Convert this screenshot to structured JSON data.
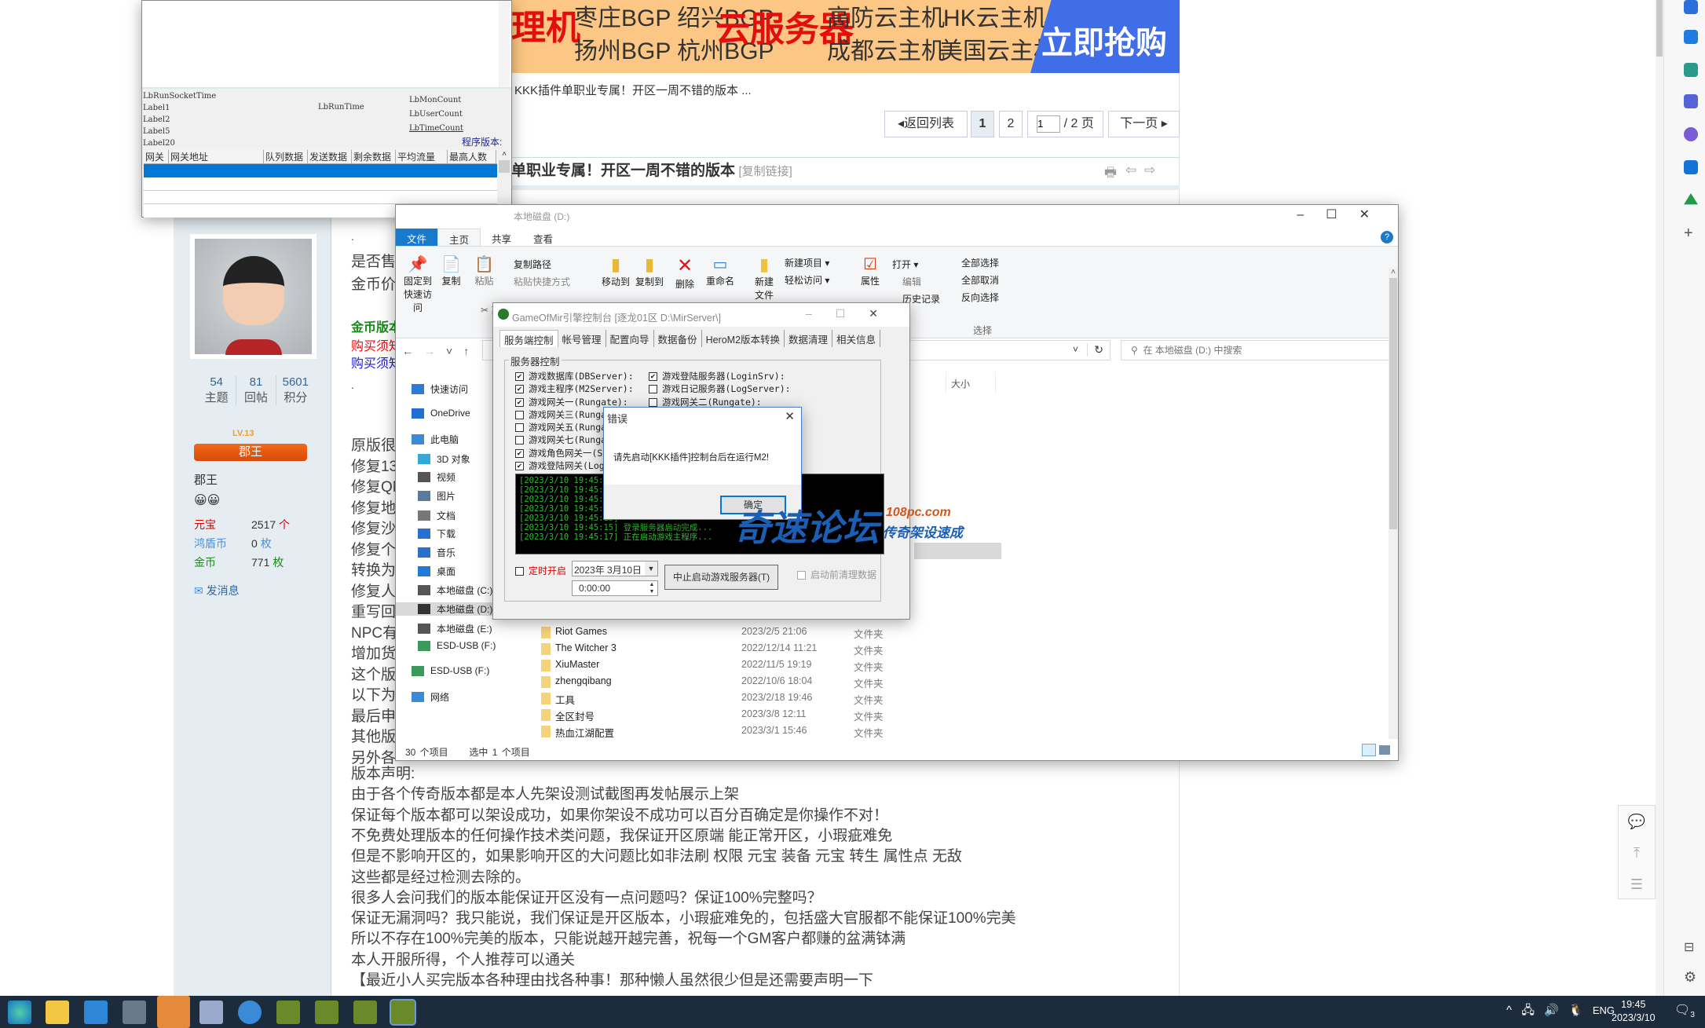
{
  "ad": {
    "left_red": "理机",
    "bgp1": "枣庄BGP 绍兴BGP",
    "bgp2": "扬州BGP 杭州BGP",
    "cloud": "云服务器",
    "host1": "高防云主机",
    "host2": "HK云主机",
    "host3": "成都云主机",
    "host4": "美国云主机",
    "buy": "立即抢购"
  },
  "thread": {
    "breadcrumb_title": "KKK插件单职业专属！开区一周不错的版本 ...",
    "title": "单职业专属！开区一周不错的版本",
    "copy_link": "[复制链接]"
  },
  "pagination": {
    "back": "返回列表",
    "page1": "1",
    "page2": "2",
    "page_input": "1",
    "total": "/ 2 页",
    "next": "下一页"
  },
  "user": {
    "topics": "54",
    "topics_label": "主题",
    "replies": "81",
    "replies_label": "回帖",
    "points": "5601",
    "points_label": "积分",
    "rank_badge": "郡王",
    "level": "LV.13",
    "rank": "郡王",
    "yuanbao_label": "元宝",
    "yuanbao": "2517",
    "yuanbao_unit": "个",
    "hongdun_label": "鸿盾币",
    "hongdun": "0",
    "hongdun_unit": "枚",
    "gold_label": "金币",
    "gold": "771",
    "gold_unit": "枚",
    "message": "发消息"
  },
  "post": {
    "top_lines": [
      ".",
      "是否售",
      "金币价",
      "."
    ],
    "gold_version": "金币版本",
    "buy_notice_red": "购买须知",
    "buy_notice_blue": "购买须知",
    "fragments": [
      "原版很",
      "修复13",
      "修复QM",
      "修复地",
      "修复沙",
      "修复个",
      "转换为",
      "修复人",
      "重写回",
      "NPC有",
      "增加货",
      "这个版",
      "以下为",
      "最后申",
      "其他版",
      "另外各"
    ],
    "lines": [
      "版本声明:",
      "由于各个传奇版本都是本人先架设测试截图再发帖展示上架",
      "保证每个版本都可以架设成功，如果你架设不成功可以百分百确定是你操作不对！",
      "不免费处理版本的任何操作技术类问题，我保证开区原端 能正常开区，小瑕疵难免",
      "但是不影响开区的，如果影响开区的大问题比如非法刷 权限 元宝 装备 元宝 转生 属性点 无敌",
      "这些都是经过检测去除的。",
      "很多人会问我们的版本能保证开区没有一点问题吗？保证100%完整吗？",
      "保证无漏洞吗？我只能说，我们保证是开区版本，小瑕疵难免的，包括盛大官服都不能保证100%完美",
      "所以不存在100%完美的版本，只能说越开越完善，祝每一个GM客户都赚的盆满钵满",
      "本人开服所得，个人推荐可以通关",
      "【最近小人买完版本各种理由找各种事！那种懒人虽然很少但是还需要声明一下"
    ]
  },
  "gate_window": {
    "labels": {
      "run_socket_time": "LbRunSocketTime",
      "label1": "Label1",
      "label2": "Label2",
      "label5": "Label5",
      "label20": "Label20",
      "run_time": "LbRunTime",
      "mon_count": "LbMonCount",
      "user_count": "LbUserCount",
      "time_count": "LbTimeCount",
      "version": "程序版本:"
    },
    "columns": [
      "网关",
      "网关地址",
      "队列数据",
      "发送数据",
      "剩余数据",
      "平均流量",
      "最高人数"
    ]
  },
  "explorer": {
    "title": "本地磁盘 (D:)",
    "tabs": [
      "文件",
      "主页",
      "共享",
      "查看"
    ],
    "ribbon": {
      "pin": "固定到快速访问",
      "copy": "复制",
      "paste": "粘贴",
      "copy_path": "复制路径",
      "paste_shortcut": "粘贴快捷方式",
      "cut": "剪切",
      "move_to": "移动到",
      "copy_to": "复制到",
      "delete": "删除",
      "rename": "重命名",
      "new_folder": "新建文件夹",
      "new_item": "新建项目",
      "easy_access": "轻松访问",
      "properties": "属性",
      "open": "打开",
      "edit": "编辑",
      "history": "历史记录",
      "select_all": "全部选择",
      "select_none": "全部取消",
      "invert": "反向选择",
      "select_group": "选择"
    },
    "search_placeholder": "在 本地磁盘 (D:) 中搜索",
    "size_header": "大小",
    "nav": [
      "快速访问",
      "OneDrive",
      "此电脑",
      "3D 对象",
      "视频",
      "图片",
      "文档",
      "下载",
      "音乐",
      "桌面",
      "本地磁盘 (C:)",
      "本地磁盘 (D:)",
      "本地磁盘 (E:)",
      "ESD-USB (F:)",
      "ESD-USB (F:)",
      "网络"
    ],
    "files": [
      {
        "name": "Riot Games",
        "date": "2023/2/5 21:06",
        "type": "文件夹"
      },
      {
        "name": "The Witcher 3",
        "date": "2022/12/14 11:21",
        "type": "文件夹"
      },
      {
        "name": "XiuMaster",
        "date": "2022/11/5 19:19",
        "type": "文件夹"
      },
      {
        "name": "zhengqibang",
        "date": "2022/10/6 18:04",
        "type": "文件夹"
      },
      {
        "name": "工具",
        "date": "2023/2/18 19:46",
        "type": "文件夹"
      },
      {
        "name": "全区封号",
        "date": "2023/3/8 12:11",
        "type": "文件夹"
      },
      {
        "name": "热血江湖配置",
        "date": "2023/3/1 15:46",
        "type": "文件夹"
      }
    ],
    "status_count": "30 个项目",
    "status_selected": "选中 1 个项目"
  },
  "gom": {
    "title": "GameOfMir引擎控制台 [逐龙01区 D:\\MirServer\\]",
    "tabs": [
      "服务端控制",
      "帐号管理",
      "配置向导",
      "数据备份",
      "HeroM2版本转换",
      "数据清理",
      "相关信息"
    ],
    "group": "服务器控制",
    "left_checks": [
      {
        "label": "游戏数据库(DBServer):",
        "checked": true
      },
      {
        "label": "游戏主程序(M2Server):",
        "checked": true
      },
      {
        "label": "游戏网关一(Rungate):",
        "checked": true
      },
      {
        "label": "游戏网关三(Rungate):",
        "checked": false
      },
      {
        "label": "游戏网关五(Rungate):",
        "checked": false
      },
      {
        "label": "游戏网关七(Rungate):",
        "checked": false
      },
      {
        "label": "游戏角色网关一(SelGate):",
        "checked": true
      },
      {
        "label": "游戏登陆网关(LoginGate):",
        "checked": true
      }
    ],
    "right_checks": [
      {
        "label": "游戏登陆服务器(LoginSrv):",
        "checked": true
      },
      {
        "label": "游戏日记服务器(LogServer):",
        "checked": false
      },
      {
        "label": "游戏网关二(Rungate):",
        "checked": false
      }
    ],
    "log": [
      "[2023/3/10 19:45:11]",
      "[2023/3/10 19:45:11]",
      "[2023/3/10 19:45:13]",
      "[2023/3/10 19:45:14]",
      "[2023/3/10 19:45:15]",
      "[2023/3/10 19:45:15] 登录服务器启动完成...",
      "[2023/3/10 19:45:17] 正在启动游戏主程序..."
    ],
    "timer_label": "定时开启",
    "date": "2023年 3月10日",
    "time": "0:00:00",
    "stop_button": "中止启动游戏服务器(T)",
    "clear_label": "启动前清理数据"
  },
  "dialog": {
    "title": "错误",
    "message": "请先启动[KKK插件]控制台后在运行M2!",
    "ok": "确定"
  },
  "watermark": {
    "main": "奇速论坛",
    "domain": "108pc.com",
    "sub": "传奇架设速成"
  },
  "taskbar": {
    "lang": "ENG",
    "time": "19:45",
    "date": "2023/3/10",
    "notifications": "3"
  }
}
